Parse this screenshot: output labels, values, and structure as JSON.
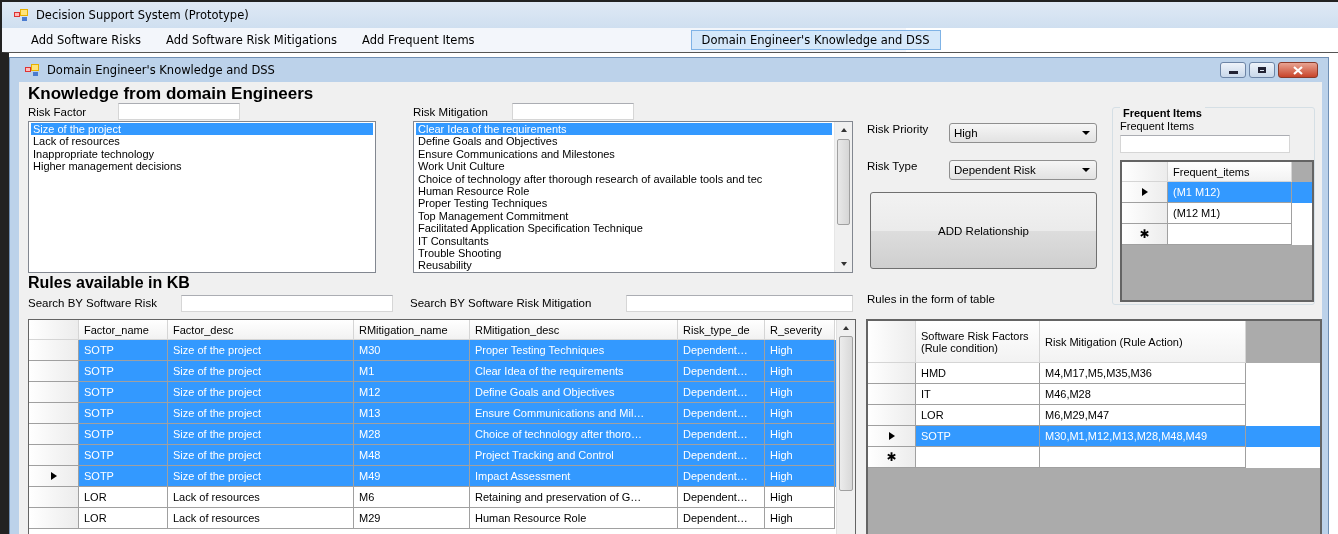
{
  "window": {
    "title": "Decision Support System (Prototype)"
  },
  "menu": [
    {
      "label": "Add Software Risks",
      "selected": false
    },
    {
      "label": "Add Software Risk Mitigations",
      "selected": false
    },
    {
      "label": "Add Frequent Items",
      "selected": false
    },
    {
      "label": "Domain Engineer's Knowledge and DSS",
      "selected": true
    }
  ],
  "child_window": {
    "title": "Domain Engineer's Knowledge and DSS"
  },
  "knowledge": {
    "heading": "Knowledge from domain Engineers",
    "risk_factor": {
      "label": "Risk Factor",
      "items": [
        {
          "label": "Size of the project",
          "selected": true
        },
        {
          "label": "Lack of resources",
          "selected": false
        },
        {
          "label": "Inappropriate technology",
          "selected": false
        },
        {
          "label": "Higher management decisions",
          "selected": false
        }
      ]
    },
    "risk_mitigation": {
      "label": "Risk Mitigation",
      "items": [
        {
          "label": "Clear Idea of the requirements",
          "selected": true
        },
        {
          "label": "Define Goals and Objectives",
          "selected": false
        },
        {
          "label": "Ensure Communications and Milestones",
          "selected": false
        },
        {
          "label": "Work Unit Culture",
          "selected": false
        },
        {
          "label": "Choice of technology after thorough research of available tools and tec",
          "selected": false
        },
        {
          "label": "Human Resource Role",
          "selected": false
        },
        {
          "label": "Proper Testing Techniques",
          "selected": false
        },
        {
          "label": "Top Management Commitment",
          "selected": false
        },
        {
          "label": "Facilitated Application Specification Technique",
          "selected": false
        },
        {
          "label": "IT Consultants",
          "selected": false
        },
        {
          "label": "Trouble Shooting",
          "selected": false
        },
        {
          "label": "Reusability",
          "selected": false
        }
      ]
    },
    "risk_priority": {
      "label": "Risk Priority",
      "value": "High"
    },
    "risk_type": {
      "label": "Risk Type",
      "value": "Dependent Risk"
    },
    "add_button": "ADD Relationship"
  },
  "frequent_items": {
    "title": "Frequent Items",
    "label": "Frequent Items",
    "columns": [
      "Frequent_items"
    ],
    "new_row_marker": "✱",
    "rows": [
      {
        "cells": [
          "(M1 M12)"
        ],
        "selected": true,
        "current": true
      },
      {
        "cells": [
          "(M12 M1)"
        ],
        "selected": false,
        "current": false
      }
    ]
  },
  "rules": {
    "heading": "Rules available in KB",
    "search_risk_label": "Search BY Software Risk",
    "search_mitigation_label": "Search BY Software Risk Mitigation",
    "table_label": "Rules in the form of table",
    "grid": {
      "columns": [
        "Factor_name",
        "Factor_desc",
        "RMitigation_name",
        "RMitigation_desc",
        "Risk_type_de",
        "R_severity"
      ],
      "rows": [
        {
          "cells": [
            "SOTP",
            "Size of the project",
            "M30",
            "Proper Testing Techniques",
            "Dependent…",
            "High"
          ],
          "selected": true,
          "current": false
        },
        {
          "cells": [
            "SOTP",
            "Size of the project",
            "M1",
            "Clear Idea of the requirements",
            "Dependent…",
            "High"
          ],
          "selected": true,
          "current": false
        },
        {
          "cells": [
            "SOTP",
            "Size of the project",
            "M12",
            "Define Goals and Objectives",
            "Dependent…",
            "High"
          ],
          "selected": true,
          "current": false
        },
        {
          "cells": [
            "SOTP",
            "Size of the project",
            "M13",
            "Ensure Communications and Mil…",
            "Dependent…",
            "High"
          ],
          "selected": true,
          "current": false
        },
        {
          "cells": [
            "SOTP",
            "Size of the project",
            "M28",
            "Choice of technology after thoro…",
            "Dependent…",
            "High"
          ],
          "selected": true,
          "current": false
        },
        {
          "cells": [
            "SOTP",
            "Size of the project",
            "M48",
            "Project Tracking and Control",
            "Dependent…",
            "High"
          ],
          "selected": true,
          "current": false
        },
        {
          "cells": [
            "SOTP",
            "Size of the project",
            "M49",
            "Impact Assessment",
            "Dependent…",
            "High"
          ],
          "selected": true,
          "current": true
        },
        {
          "cells": [
            "LOR",
            "Lack of resources",
            "M6",
            "Retaining and preservation of G…",
            "Dependent…",
            "High"
          ],
          "selected": false,
          "current": false
        },
        {
          "cells": [
            "LOR",
            "Lack of resources",
            "M29",
            "Human Resource Role",
            "Dependent…",
            "High"
          ],
          "selected": false,
          "current": false
        }
      ]
    },
    "rule_table": {
      "columns": [
        "Software Risk Factors (Rule condition)",
        "Risk Mitigation (Rule Action)"
      ],
      "new_row_marker": "✱",
      "rows": [
        {
          "cells": [
            "HMD",
            "M4,M17,M5,M35,M36"
          ],
          "selected": false,
          "current": false
        },
        {
          "cells": [
            "IT",
            "M46,M28"
          ],
          "selected": false,
          "current": false
        },
        {
          "cells": [
            "LOR",
            "M6,M29,M47"
          ],
          "selected": false,
          "current": false
        },
        {
          "cells": [
            "SOTP",
            "M30,M1,M12,M13,M28,M48,M49"
          ],
          "selected": true,
          "current": true
        }
      ]
    }
  }
}
